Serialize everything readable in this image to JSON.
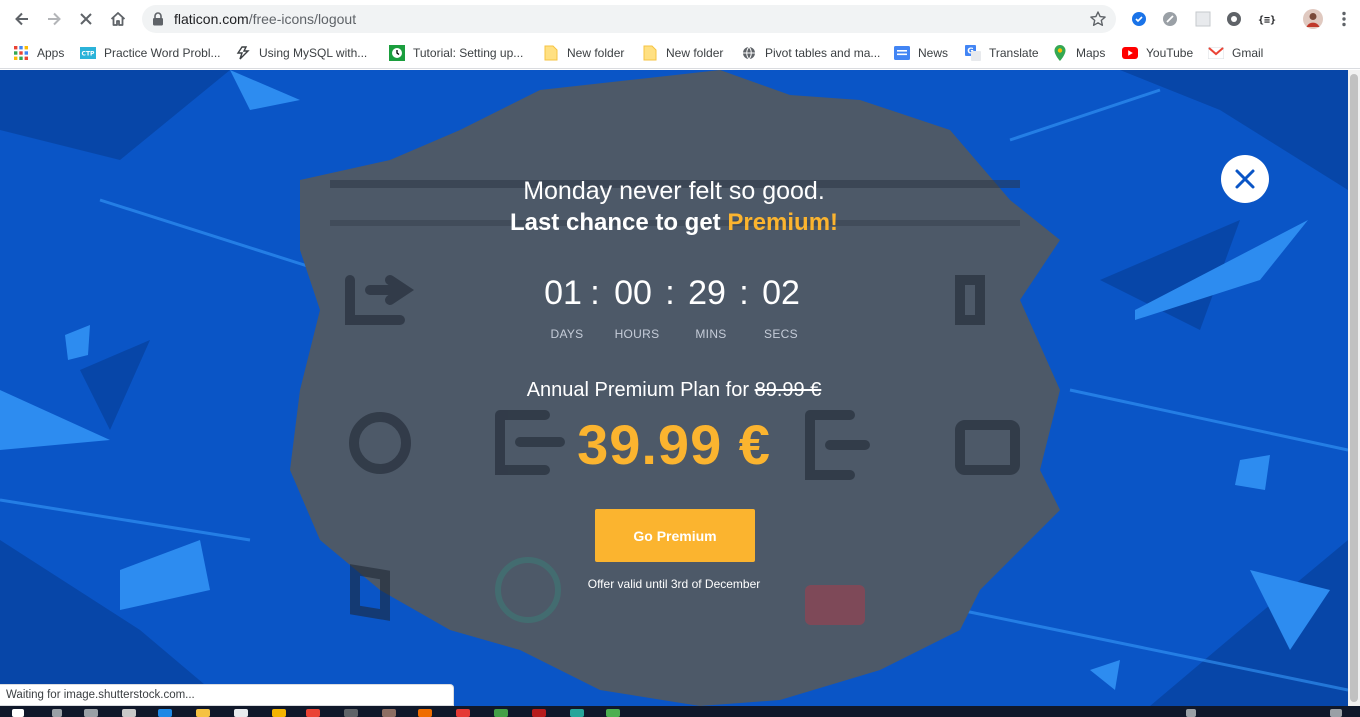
{
  "browser": {
    "url_host": "flaticon.com",
    "url_path": "/free-icons/logout",
    "bookmarks": [
      {
        "label": "Apps",
        "icon": "apps-grid-icon"
      },
      {
        "label": "Practice Word Probl...",
        "icon": "ctp-icon"
      },
      {
        "label": "Using MySQL with...",
        "icon": "code-icon"
      },
      {
        "label": "Tutorial: Setting up...",
        "icon": "clock-icon"
      },
      {
        "label": "New folder",
        "icon": "folder-icon"
      },
      {
        "label": "New folder",
        "icon": "folder-icon"
      },
      {
        "label": "Pivot tables and ma...",
        "icon": "globe-icon"
      },
      {
        "label": "News",
        "icon": "google-news-icon"
      },
      {
        "label": "Translate",
        "icon": "translate-icon"
      },
      {
        "label": "Maps",
        "icon": "maps-icon"
      },
      {
        "label": "YouTube",
        "icon": "youtube-icon"
      },
      {
        "label": "Gmail",
        "icon": "gmail-icon"
      }
    ]
  },
  "promo": {
    "line1": "Monday never felt so good.",
    "line2_prefix": "Last chance to get ",
    "line2_highlight": "Premium!",
    "countdown": [
      {
        "value": "01",
        "label": "DAYS"
      },
      {
        "value": "00",
        "label": "HOURS"
      },
      {
        "value": "29",
        "label": "MINS"
      },
      {
        "value": "02",
        "label": "SECS"
      }
    ],
    "separator": ":",
    "plan_text": "Annual Premium Plan for ",
    "old_price": "89.99 €",
    "price": "39.99 €",
    "cta": "Go Premium",
    "offer_note": "Offer valid until 3rd of December"
  },
  "status_bar": "Waiting for image.shutterstock.com...",
  "colors": {
    "brand_blue": "#0a55c6",
    "accent_yellow": "#fbb42f",
    "panel_gray": "#4d5968"
  }
}
